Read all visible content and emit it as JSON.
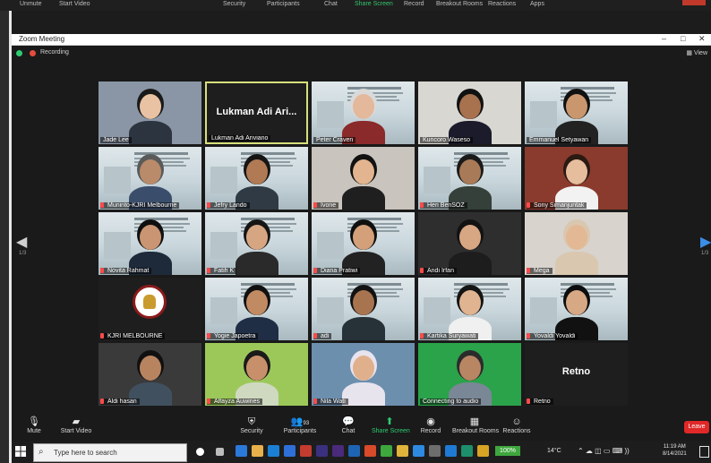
{
  "top_toolbar": {
    "items": [
      "Unmute",
      "Start Video",
      "Security",
      "Participants",
      "Chat",
      "Share Screen",
      "Record",
      "Breakout Rooms",
      "Reactions",
      "Apps"
    ]
  },
  "window": {
    "title": "Zoom Meeting",
    "recording_label": "Recording",
    "view_label": "View",
    "minimize": "–",
    "maximize": "□",
    "close": "✕"
  },
  "navigation": {
    "prev_arrow": "◀",
    "next_arrow": "▶",
    "left_page": "1/3",
    "right_page": "1/3"
  },
  "tiles": [
    {
      "name": "Jade Lee",
      "big": "",
      "muted": false,
      "kind": "person",
      "bg": "#8a96a6",
      "skin": "#e8c2a3",
      "cloth": "#2c3440",
      "hair": "#1a1a1a"
    },
    {
      "name": "Lukman Adi Ariviano",
      "big": "Lukman Adi Ari...",
      "muted": false,
      "kind": "blank"
    },
    {
      "name": "Peter Craven",
      "big": "",
      "muted": false,
      "kind": "slide-person",
      "skin": "#e3b89b",
      "cloth": "#8b2a2a",
      "hair": "#d9d9d9"
    },
    {
      "name": "Kuncoro Waseso",
      "big": "",
      "muted": false,
      "kind": "person",
      "bg": "#d9d7d2",
      "skin": "#a8724f",
      "cloth": "#1b1b2b",
      "hair": "#111111"
    },
    {
      "name": "Emmanuel Setyawan",
      "big": "",
      "muted": false,
      "kind": "slide-person",
      "skin": "#c9966e",
      "cloth": "#222222",
      "hair": "#111111"
    },
    {
      "name": "Muninto-KJRI Melbourne",
      "big": "",
      "muted": true,
      "kind": "slide-person",
      "skin": "#b98b6a",
      "cloth": "#3a4d6b",
      "hair": "#5a5a5a"
    },
    {
      "name": "Jefry Lando",
      "big": "",
      "muted": true,
      "kind": "slide-person",
      "skin": "#b07a55",
      "cloth": "#2f3a45",
      "hair": "#151515"
    },
    {
      "name": "Ivone",
      "big": "",
      "muted": true,
      "kind": "person",
      "bg": "#c9c4bd",
      "skin": "#e2b48f",
      "cloth": "#1f1f1f",
      "hair": "#121212"
    },
    {
      "name": "Heri BenSOZ",
      "big": "",
      "muted": true,
      "kind": "slide-person",
      "skin": "#a97a57",
      "cloth": "#35403a",
      "hair": "#1a1a1a"
    },
    {
      "name": "Sony Simanjuntak",
      "big": "",
      "muted": true,
      "kind": "person",
      "bg": "#8a3b2e",
      "skin": "#e6bd9d",
      "cloth": "#f2f2f2",
      "hair": "#2a1a12"
    },
    {
      "name": "Novita Rahmat",
      "big": "",
      "muted": true,
      "kind": "slide-person",
      "skin": "#c99572",
      "cloth": "#1e2a3a",
      "hair": "#101010"
    },
    {
      "name": "Fatih K",
      "big": "",
      "muted": true,
      "kind": "slide-person",
      "skin": "#d6a682",
      "cloth": "#2a2a2a",
      "hair": "#151515"
    },
    {
      "name": "Diana Pratiwi",
      "big": "",
      "muted": true,
      "kind": "slide-person",
      "skin": "#d3a07a",
      "cloth": "#222222",
      "hair": "#0f0f0f"
    },
    {
      "name": "Andi Irfan",
      "big": "",
      "muted": true,
      "kind": "person",
      "bg": "#2e2e2e",
      "skin": "#d7a683",
      "cloth": "#1d1d1d",
      "hair": "#121212"
    },
    {
      "name": "Mega",
      "big": "",
      "muted": true,
      "kind": "person",
      "bg": "#d8d3cc",
      "skin": "#e3b995",
      "cloth": "#d9c7b0",
      "hair": "#d9c7b0"
    },
    {
      "name": "KJRI MELBOURNE",
      "big": "",
      "muted": true,
      "kind": "logo"
    },
    {
      "name": "Yogie Japoetra",
      "big": "",
      "muted": true,
      "kind": "slide-person",
      "skin": "#c08a63",
      "cloth": "#1f2e45",
      "hair": "#101010"
    },
    {
      "name": "adi",
      "big": "",
      "muted": true,
      "kind": "slide-person",
      "skin": "#a8744f",
      "cloth": "#263238",
      "hair": "#121212"
    },
    {
      "name": "Kartika Suryawati",
      "big": "",
      "muted": true,
      "kind": "slide-person",
      "skin": "#e0b391",
      "cloth": "#f0f0f0",
      "hair": "#141414"
    },
    {
      "name": "Yovaldi Yovaldi",
      "big": "",
      "muted": true,
      "kind": "slide-person",
      "skin": "#d6a884",
      "cloth": "#111111",
      "hair": "#0d0d0d"
    },
    {
      "name": "Aldi hasan",
      "big": "",
      "muted": true,
      "kind": "person",
      "bg": "#3a3a3a",
      "skin": "#b88460",
      "cloth": "#40505f",
      "hair": "#101010"
    },
    {
      "name": "Alfayza Auwines",
      "big": "",
      "muted": true,
      "kind": "person",
      "bg": "#9cc85a",
      "skin": "#c8906a",
      "cloth": "#cfd9c0",
      "hair": "#1a1a1a"
    },
    {
      "name": "Nila Wati",
      "big": "",
      "muted": true,
      "kind": "person",
      "bg": "#6d8fae",
      "skin": "#e0b08c",
      "cloth": "#e8e4ee",
      "hair": "#e8e4ee"
    },
    {
      "name": "Connecting to audio",
      "big": "",
      "muted": false,
      "kind": "person",
      "bg": "#2aa34a",
      "skin": "#b98664",
      "cloth": "#7a8796",
      "hair": "#2b2b2b"
    },
    {
      "name": "Retno",
      "big": "Retno",
      "muted": true,
      "kind": "blank"
    }
  ],
  "toolbar": {
    "mute": "Mute",
    "start_video": "Start Video",
    "security": "Security",
    "participants": "Participants",
    "participants_count": "93",
    "chat": "Chat",
    "share_screen": "Share Screen",
    "record": "Record",
    "breakout_rooms": "Breakout Rooms",
    "reactions": "Reactions",
    "leave": "Leave"
  },
  "taskbar": {
    "search_placeholder": "Type here to search",
    "zoom_percent": "100%",
    "temperature": "14°C",
    "time": "11:19 AM",
    "date": "8/14/2021"
  },
  "colors": {
    "accent_green": "#2ecc71",
    "leave_red": "#e02828",
    "active_speaker_border": "#d6e07a"
  }
}
